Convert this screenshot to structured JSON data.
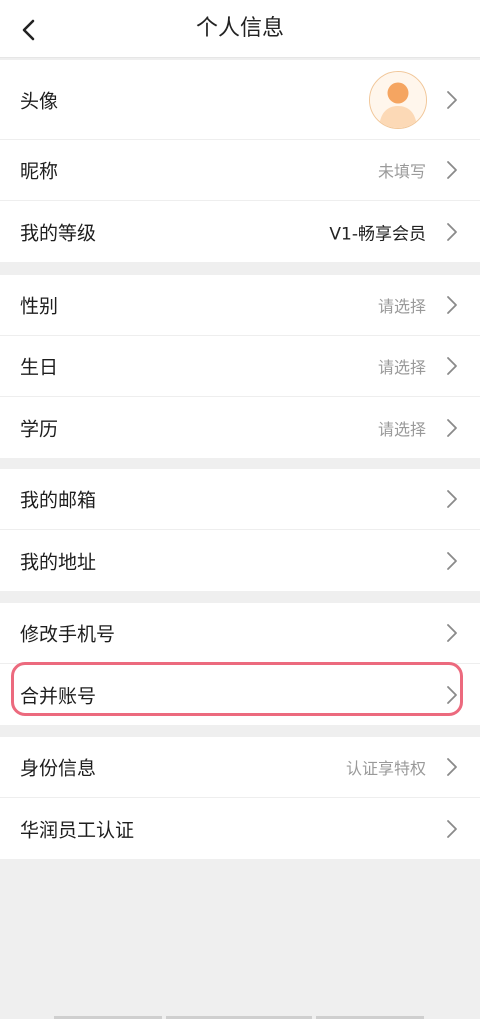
{
  "header": {
    "title": "个人信息",
    "back_icon": "chevron-left-icon"
  },
  "groups": [
    {
      "rows": [
        {
          "label": "头像",
          "value": "",
          "has_avatar": true
        },
        {
          "label": "昵称",
          "value": "未填写"
        },
        {
          "label": "我的等级",
          "value": "V1-畅享会员"
        }
      ]
    },
    {
      "rows": [
        {
          "label": "性别",
          "value": "请选择"
        },
        {
          "label": "生日",
          "value": "请选择"
        },
        {
          "label": "学历",
          "value": "请选择"
        }
      ]
    },
    {
      "rows": [
        {
          "label": "我的邮箱",
          "value": ""
        },
        {
          "label": "我的地址",
          "value": ""
        }
      ]
    },
    {
      "rows": [
        {
          "label": "修改手机号",
          "value": ""
        },
        {
          "label": "合并账号",
          "value": "",
          "highlighted": true
        }
      ]
    },
    {
      "rows": [
        {
          "label": "身份信息",
          "value": "认证享特权"
        },
        {
          "label": "华润员工认证",
          "value": ""
        }
      ]
    }
  ],
  "colors": {
    "highlight": "#ec6a7e",
    "avatar_orange": "#f5a561",
    "chevron": "#8a8a8a",
    "value_text": "#9a9a9a"
  }
}
